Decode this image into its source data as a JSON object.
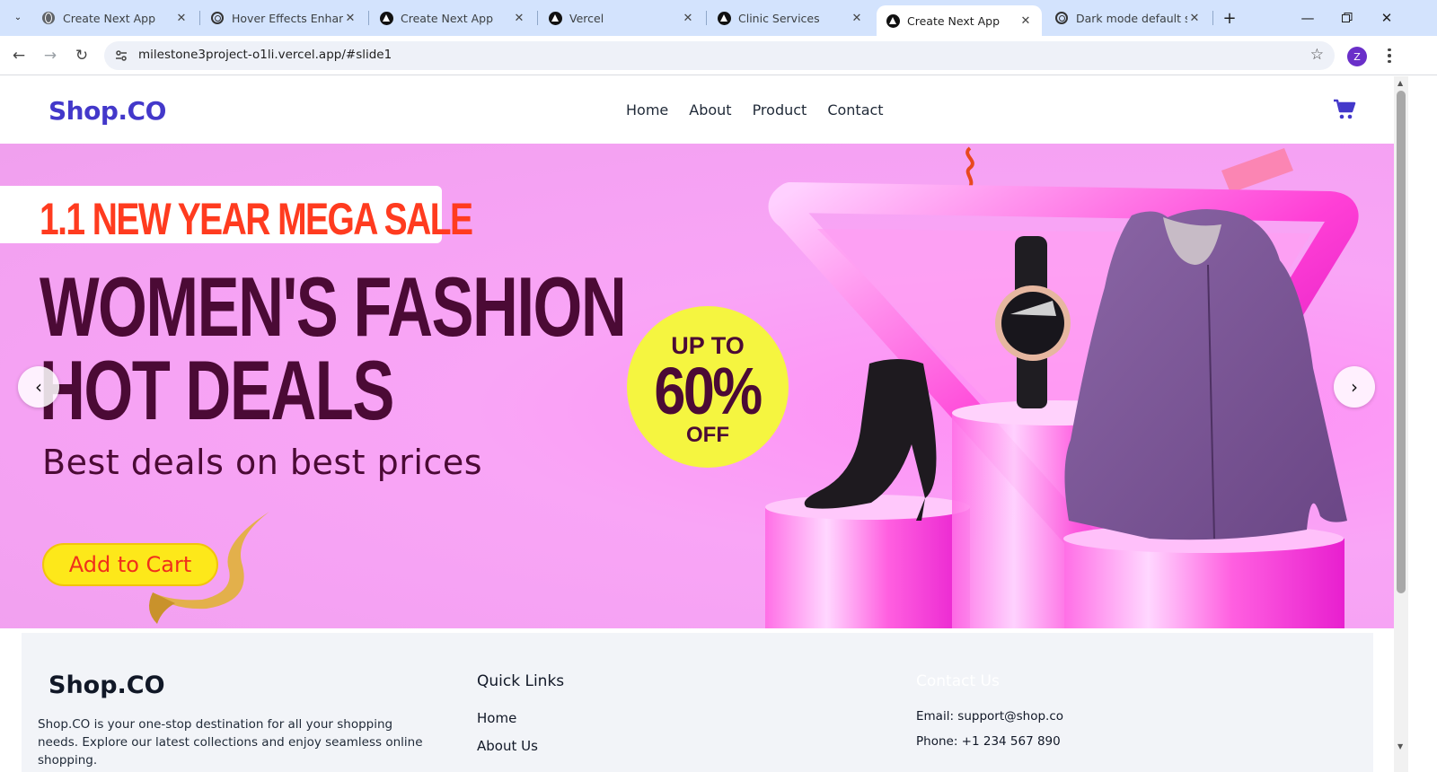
{
  "browser": {
    "tabs": [
      {
        "title": "Create Next App",
        "favicon": "globe-icon",
        "active": false
      },
      {
        "title": "Hover Effects Enhance",
        "favicon": "openai-icon",
        "active": false
      },
      {
        "title": "Create Next App",
        "favicon": "vercel-icon",
        "active": false
      },
      {
        "title": "Vercel",
        "favicon": "vercel-icon",
        "active": false
      },
      {
        "title": "Clinic Services",
        "favicon": "vercel-icon",
        "active": false
      },
      {
        "title": "Create Next App",
        "favicon": "vercel-icon",
        "active": true
      },
      {
        "title": "Dark mode default set",
        "favicon": "openai-icon",
        "active": false
      }
    ],
    "url": "milestone3project-o1li.vercel.app/#slide1",
    "profile_initial": "Z"
  },
  "header": {
    "logo": "Shop.CO",
    "nav": [
      "Home",
      "About",
      "Product",
      "Contact"
    ]
  },
  "hero": {
    "sale_banner": "1.1 NEW YEAR MEGA SALE",
    "headline_1": "WOMEN'S FASHION",
    "headline_2": "HOT DEALS",
    "subhead": "Best deals on best prices",
    "cta": "Add to Cart",
    "badge_1": "UP TO",
    "badge_2": "60%",
    "badge_3": "OFF",
    "prev": "‹",
    "next": "›"
  },
  "footer": {
    "logo": "Shop.CO",
    "description": "Shop.CO is your one-stop destination for all your shopping needs. Explore our latest collections and enjoy seamless online shopping.",
    "quick_links_title": "Quick Links",
    "quick_links": [
      "Home",
      "About Us"
    ],
    "contact_title": "Contact Us",
    "email": "Email: support@shop.co",
    "phone": "Phone: +1 234 567 890"
  },
  "colors": {
    "brand": "#4338ca",
    "hero_bg": "#f5a2f3",
    "sale_red": "#ff3b1f",
    "headline": "#4b0a35",
    "badge_yellow": "#f5f540",
    "cta_yellow": "#fde81a"
  }
}
